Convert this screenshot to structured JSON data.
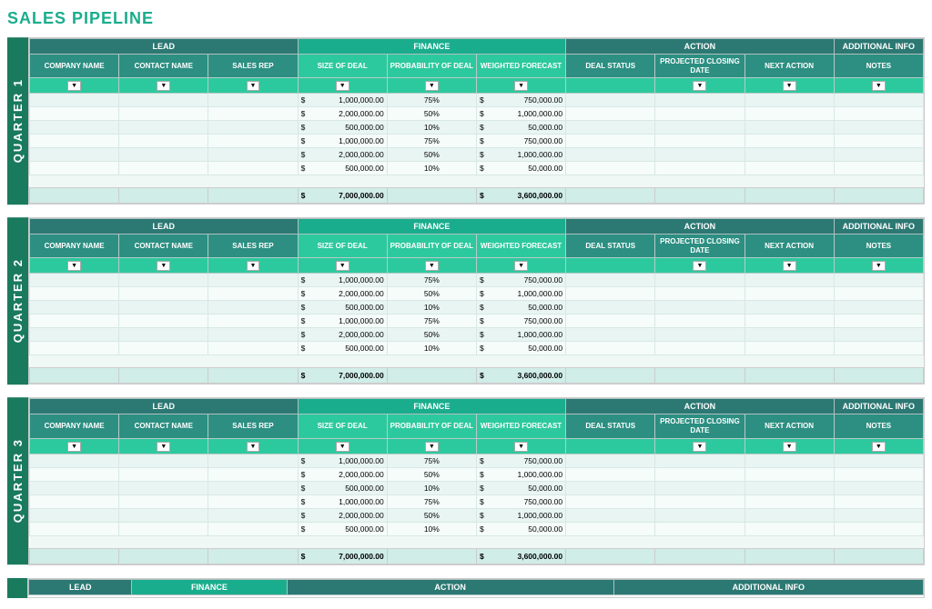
{
  "page": {
    "title": "SALES PIPELINE"
  },
  "groups": {
    "lead_label": "LEAD",
    "finance_label": "FINANCE",
    "action_label": "ACTION",
    "addinfo_label": "ADDITIONAL INFO"
  },
  "columns": {
    "company": "COMPANY NAME",
    "contact": "CONTACT NAME",
    "salesrep": "SALES REP",
    "sizedeal": "SIZE OF DEAL",
    "probdeal": "PROBABILITY OF DEAL",
    "weighted": "WEIGHTED FORECAST",
    "dealstatus": "DEAL STATUS",
    "closing": "PROJECTED CLOSING DATE",
    "nextaction": "NEXT ACTION",
    "notes": "NOTES"
  },
  "quarters": [
    {
      "label": "QUARTER 1",
      "rows": [
        {
          "size": "1,000,000.00",
          "prob": "75%",
          "wf": "750,000.00"
        },
        {
          "size": "2,000,000.00",
          "prob": "50%",
          "wf": "1,000,000.00"
        },
        {
          "size": "500,000.00",
          "prob": "10%",
          "wf": "50,000.00"
        },
        {
          "size": "1,000,000.00",
          "prob": "75%",
          "wf": "750,000.00"
        },
        {
          "size": "2,000,000.00",
          "prob": "50%",
          "wf": "1,000,000.00"
        },
        {
          "size": "500,000.00",
          "prob": "10%",
          "wf": "50,000.00"
        }
      ],
      "total_size": "7,000,000.00",
      "total_wf": "3,600,000.00"
    },
    {
      "label": "QUARTER 2",
      "rows": [
        {
          "size": "1,000,000.00",
          "prob": "75%",
          "wf": "750,000.00"
        },
        {
          "size": "2,000,000.00",
          "prob": "50%",
          "wf": "1,000,000.00"
        },
        {
          "size": "500,000.00",
          "prob": "10%",
          "wf": "50,000.00"
        },
        {
          "size": "1,000,000.00",
          "prob": "75%",
          "wf": "750,000.00"
        },
        {
          "size": "2,000,000.00",
          "prob": "50%",
          "wf": "1,000,000.00"
        },
        {
          "size": "500,000.00",
          "prob": "10%",
          "wf": "50,000.00"
        }
      ],
      "total_size": "7,000,000.00",
      "total_wf": "3,600,000.00"
    },
    {
      "label": "QUARTER 3",
      "rows": [
        {
          "size": "1,000,000.00",
          "prob": "75%",
          "wf": "750,000.00"
        },
        {
          "size": "2,000,000.00",
          "prob": "50%",
          "wf": "1,000,000.00"
        },
        {
          "size": "500,000.00",
          "prob": "10%",
          "wf": "50,000.00"
        },
        {
          "size": "1,000,000.00",
          "prob": "75%",
          "wf": "750,000.00"
        },
        {
          "size": "2,000,000.00",
          "prob": "50%",
          "wf": "1,000,000.00"
        },
        {
          "size": "500,000.00",
          "prob": "10%",
          "wf": "50,000.00"
        }
      ],
      "total_size": "7,000,000.00",
      "total_wf": "3,600,000.00"
    }
  ],
  "filter_symbol": "▼",
  "dollar_sign": "$"
}
